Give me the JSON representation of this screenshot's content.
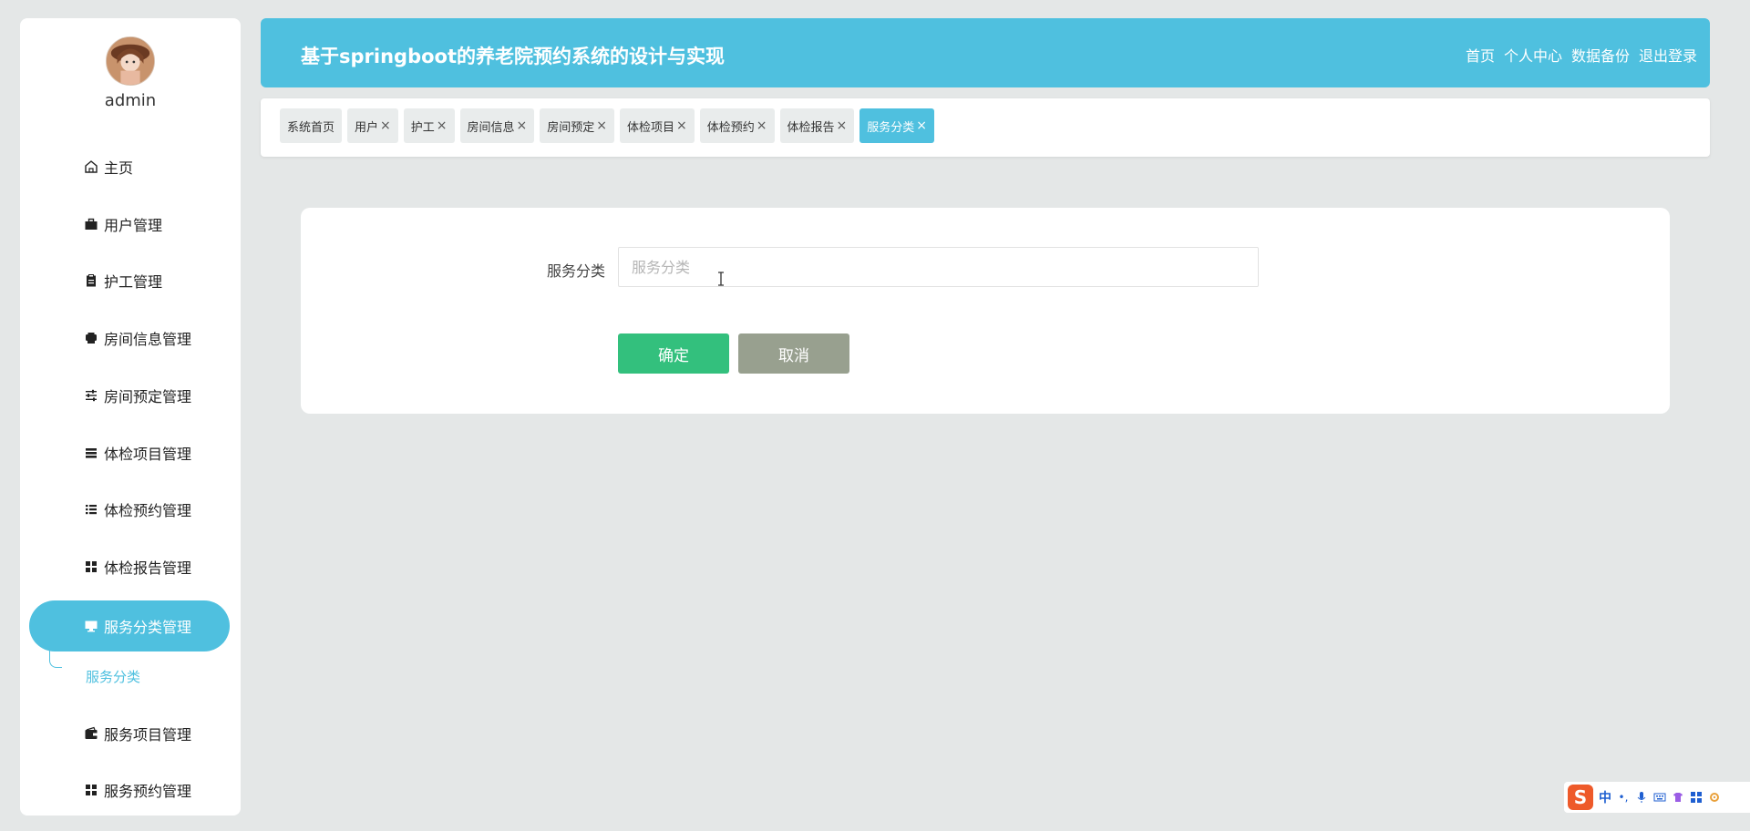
{
  "app": {
    "title": "基于springboot的养老院预约系统的设计与实现",
    "accent_color": "#4fc0df"
  },
  "header": {
    "nav": [
      "首页",
      "个人中心",
      "数据备份",
      "退出登录"
    ]
  },
  "sidebar": {
    "user": "admin",
    "items": [
      {
        "label": "主页",
        "icon": "home-icon"
      },
      {
        "label": "用户管理",
        "icon": "briefcase-icon"
      },
      {
        "label": "护工管理",
        "icon": "clipboard-icon"
      },
      {
        "label": "房间信息管理",
        "icon": "printer-icon"
      },
      {
        "label": "房间预定管理",
        "icon": "sliders-icon"
      },
      {
        "label": "体检项目管理",
        "icon": "list-icon"
      },
      {
        "label": "体检预约管理",
        "icon": "list-indent-icon"
      },
      {
        "label": "体检报告管理",
        "icon": "grid-icon"
      },
      {
        "label": "服务分类管理",
        "icon": "monitor-icon",
        "active": true
      },
      {
        "label": "服务项目管理",
        "icon": "wallet-icon"
      },
      {
        "label": "服务预约管理",
        "icon": "grid-icon"
      }
    ],
    "submenu": {
      "label": "服务分类"
    }
  },
  "tabs": [
    {
      "label": "系统首页",
      "closable": false
    },
    {
      "label": "用户",
      "closable": true
    },
    {
      "label": "护工",
      "closable": true
    },
    {
      "label": "房间信息",
      "closable": true
    },
    {
      "label": "房间预定",
      "closable": true
    },
    {
      "label": "体检项目",
      "closable": true
    },
    {
      "label": "体检预约",
      "closable": true
    },
    {
      "label": "体检报告",
      "closable": true
    },
    {
      "label": "服务分类",
      "closable": true,
      "active": true
    }
  ],
  "tab_close_glyph": "×",
  "form": {
    "field_label": "服务分类",
    "field_value": "",
    "field_placeholder": "服务分类",
    "confirm_label": "确定",
    "cancel_label": "取消"
  },
  "ime": {
    "logo": "S",
    "mode": "中",
    "punct": "•,"
  }
}
